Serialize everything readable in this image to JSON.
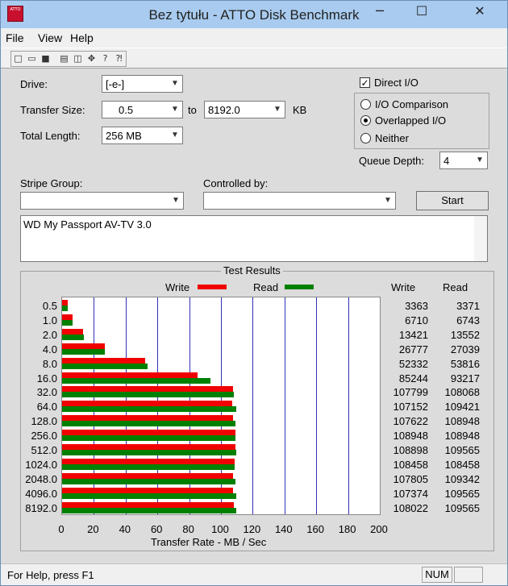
{
  "window": {
    "title": "Bez tytułu - ATTO Disk Benchmark",
    "icon_text": "ATTO"
  },
  "menu": [
    "File",
    "View",
    "Help"
  ],
  "toolbar_icons": [
    "new-icon",
    "open-icon",
    "save-icon",
    "print-icon",
    "print-preview-icon",
    "move-icon",
    "help-icon",
    "context-help-icon"
  ],
  "settings": {
    "drive_label": "Drive:",
    "drive_value": "[-e-]",
    "transfer_size_label": "Transfer Size:",
    "transfer_from": "0.5",
    "to_label": "to",
    "transfer_to": "8192.0",
    "kb_label": "KB",
    "total_length_label": "Total Length:",
    "total_length_value": "256 MB",
    "direct_io_label": "Direct I/O",
    "direct_io_checked": true,
    "io_comparison_label": "I/O Comparison",
    "overlapped_io_label": "Overlapped I/O",
    "neither_label": "Neither",
    "selected_mode": "Overlapped I/O",
    "queue_depth_label": "Queue Depth:",
    "queue_depth_value": "4",
    "stripe_group_label": "Stripe Group:",
    "stripe_group_value": "",
    "controlled_by_label": "Controlled by:",
    "controlled_by_value": "",
    "start_label": "Start",
    "description": "WD My Passport AV-TV 3.0"
  },
  "results": {
    "title": "Test Results",
    "legend_write": "Write",
    "legend_read": "Read",
    "col_write": "Write",
    "col_read": "Read",
    "rows": [
      {
        "size": "0.5",
        "write": "3363",
        "read": "3371"
      },
      {
        "size": "1.0",
        "write": "6710",
        "read": "6743"
      },
      {
        "size": "2.0",
        "write": "13421",
        "read": "13552"
      },
      {
        "size": "4.0",
        "write": "26777",
        "read": "27039"
      },
      {
        "size": "8.0",
        "write": "52332",
        "read": "53816"
      },
      {
        "size": "16.0",
        "write": "85244",
        "read": "93217"
      },
      {
        "size": "32.0",
        "write": "107799",
        "read": "108068"
      },
      {
        "size": "64.0",
        "write": "107152",
        "read": "109421"
      },
      {
        "size": "128.0",
        "write": "107622",
        "read": "108948"
      },
      {
        "size": "256.0",
        "write": "108948",
        "read": "108948"
      },
      {
        "size": "512.0",
        "write": "108898",
        "read": "109565"
      },
      {
        "size": "1024.0",
        "write": "108458",
        "read": "108458"
      },
      {
        "size": "2048.0",
        "write": "107805",
        "read": "109342"
      },
      {
        "size": "4096.0",
        "write": "107374",
        "read": "109565"
      },
      {
        "size": "8192.0",
        "write": "108022",
        "read": "109565"
      }
    ]
  },
  "chart_data": {
    "type": "bar",
    "orientation": "horizontal",
    "categories": [
      "0.5",
      "1.0",
      "2.0",
      "4.0",
      "8.0",
      "16.0",
      "32.0",
      "64.0",
      "128.0",
      "256.0",
      "512.0",
      "1024.0",
      "2048.0",
      "4096.0",
      "8192.0"
    ],
    "series": [
      {
        "name": "Write",
        "color": "#f00000",
        "values": [
          3.363,
          6.71,
          13.421,
          26.777,
          52.332,
          85.244,
          107.799,
          107.152,
          107.622,
          108.948,
          108.898,
          108.458,
          107.805,
          107.374,
          108.022
        ]
      },
      {
        "name": "Read",
        "color": "#008000",
        "values": [
          3.371,
          6.743,
          13.552,
          27.039,
          53.816,
          93.217,
          108.068,
          109.421,
          108.948,
          108.948,
          109.565,
          108.458,
          109.342,
          109.565,
          109.565
        ]
      }
    ],
    "xlabel": "Transfer Rate - MB / Sec",
    "xlim": [
      0,
      200
    ],
    "xticks": [
      "0",
      "20",
      "40",
      "60",
      "80",
      "100",
      "120",
      "140",
      "160",
      "180",
      "200"
    ],
    "grid": true,
    "legend_position": "top"
  },
  "status": {
    "help_text": "For Help, press F1",
    "num_indicator": "NUM"
  }
}
